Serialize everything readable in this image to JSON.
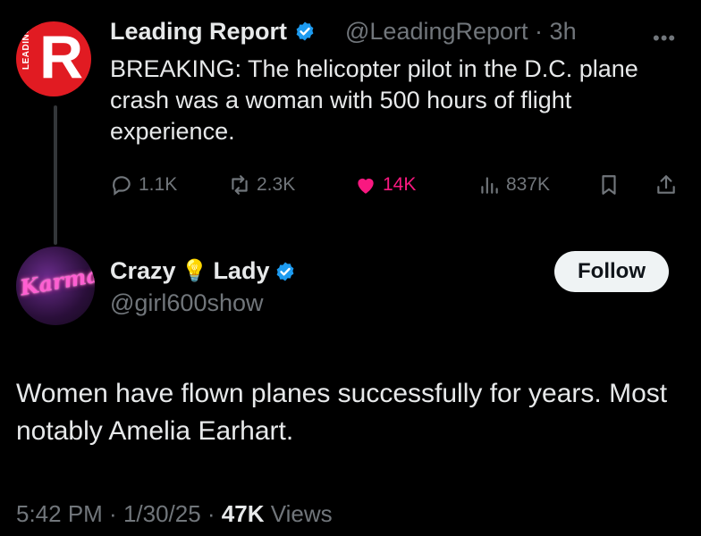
{
  "tweet1": {
    "avatar_letter": "R",
    "avatar_side_text": "LEADING",
    "name": "Leading Report",
    "handle": "@LeadingReport",
    "time": "3h",
    "more_label": "•••",
    "body": "BREAKING: The helicopter pilot in the D.C. plane crash was a woman with 500 hours of flight experience.",
    "replies": "1.1K",
    "reposts": "2.3K",
    "likes": "14K",
    "views": "837K",
    "like_color": "#f91880",
    "verified_color": "#1d9bf0"
  },
  "tweet2": {
    "avatar_text": "Karma",
    "name_part1": "Crazy",
    "name_emoji": "💡",
    "name_part2": "Lady",
    "handle": "@girl600show",
    "follow_label": "Follow",
    "body": "Women have flown planes successfully for years. Most notably Amelia Earhart.",
    "time": "5:42 PM",
    "date": "1/30/25",
    "views_count": "47K",
    "views_label": "Views"
  }
}
